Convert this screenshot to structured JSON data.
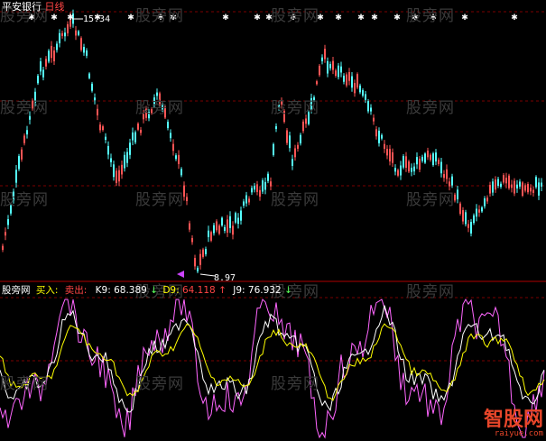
{
  "header": {
    "stock_name": "平安银行",
    "period": "日线"
  },
  "high_label": "15.34",
  "low_label": "8.97",
  "indicator": {
    "panel_name": "股旁网",
    "buy_label": "买入:",
    "sell_label": "卖出:",
    "k_label": "K9:",
    "k_value": "68.389",
    "k_arrow": "↓",
    "d_label": "D9:",
    "d_value": "64.118",
    "d_arrow": "↑",
    "j_label": "J9:",
    "j_value": "76.932",
    "j_arrow": "↓"
  },
  "watermark_text": "股旁网",
  "logo": {
    "main": "智股网",
    "sub": "raiyue.com"
  },
  "colors": {
    "background": "#000000",
    "up_candle": "#ff5555",
    "down_candle": "#55ffff",
    "grid": "#8b0000",
    "k_line": "#ffffff",
    "d_line": "#ffff00",
    "j_line": "#ff66ff",
    "signal_marker": "#ffffff"
  }
}
